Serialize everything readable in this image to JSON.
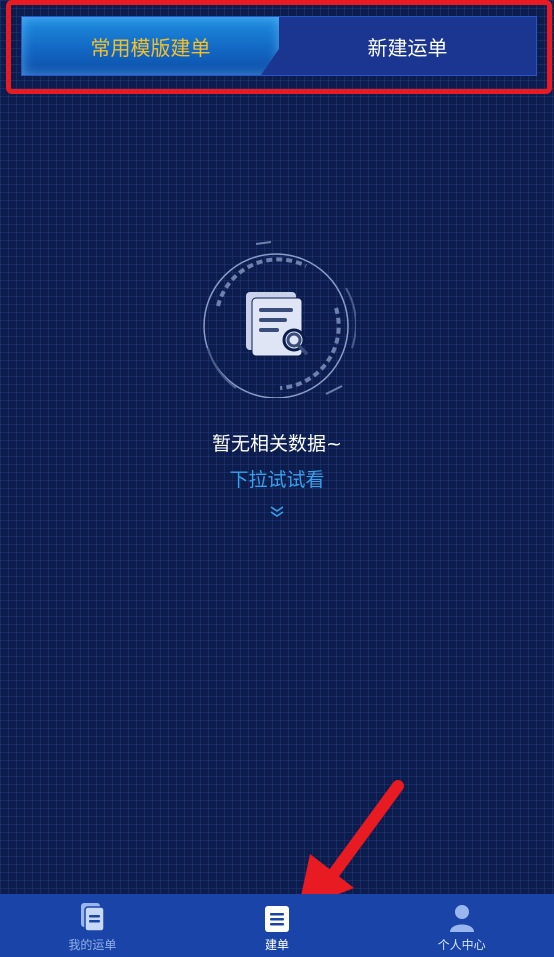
{
  "tabs": {
    "active_label": "常用模版建单",
    "inactive_label": "新建运单"
  },
  "empty_state": {
    "title": "暂无相关数据~",
    "hint": "下拉试试看",
    "icon": "document-search-icon"
  },
  "bottom_nav": {
    "items": [
      {
        "label": "我的运单",
        "icon": "documents-icon"
      },
      {
        "label": "建单",
        "icon": "list-doc-icon"
      },
      {
        "label": "个人中心",
        "icon": "user-icon"
      }
    ]
  },
  "colors": {
    "background": "#0b1c4d",
    "active_tab_text": "#f4c02a",
    "hint_text": "#3aa0ea",
    "highlight": "#e81a22",
    "nav_bg": "#1a44a8"
  }
}
